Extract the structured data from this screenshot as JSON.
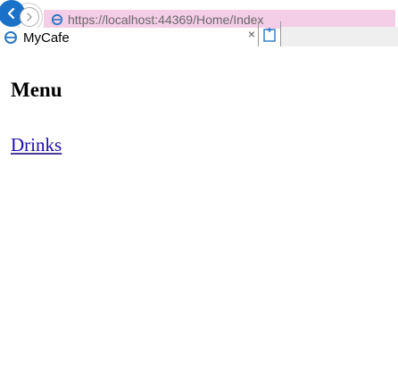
{
  "browser": {
    "address_url": "https://localhost:44369/Home/Index",
    "tab_title": "MyCafe",
    "tab_close": "×",
    "icons": {
      "back": "back-arrow-icon",
      "forward": "forward-arrow-icon",
      "address": "edge-logo-icon",
      "tab": "edge-logo-icon",
      "new_tab": "new-tab-icon"
    },
    "colors": {
      "back_button": "#1a72c8",
      "address_highlight": "#f4cde6",
      "tab_strip": "#efefef"
    }
  },
  "page": {
    "heading": "Menu",
    "links": [
      {
        "label": "Drinks"
      }
    ]
  }
}
